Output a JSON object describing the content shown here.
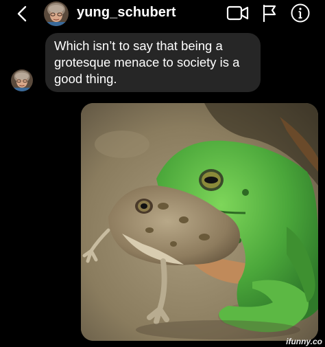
{
  "header": {
    "username": "yung_schubert",
    "icons": {
      "back": "chevron-left-icon",
      "video": "video-camera-icon",
      "flag": "flag-icon",
      "info": "info-icon"
    }
  },
  "message": {
    "text": "Which isn’t to say that being a grotesque menace to society is a good thing."
  },
  "photo": {
    "subject": "frog-photo"
  },
  "watermark": "ifunny.co",
  "colors": {
    "background": "#000000",
    "bubble": "#262626",
    "text": "#ffffff"
  }
}
